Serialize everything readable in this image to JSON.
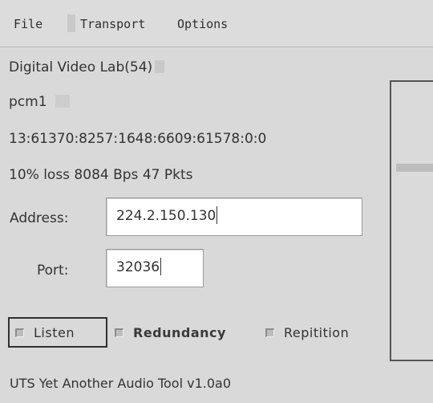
{
  "menu": {
    "items": [
      {
        "label": "File"
      },
      {
        "label": "Transport"
      },
      {
        "label": "Options"
      }
    ]
  },
  "session": {
    "name": "Digital Video Lab(54)",
    "codec": "pcm1",
    "counters": "13:61370:8257:1648:6609:61578:0:0",
    "stats": "10% loss 8084 Bps 47 Pkts"
  },
  "address": {
    "label": "Address:",
    "value": "224.2.150.130"
  },
  "port": {
    "label": "Port:",
    "value": "32036"
  },
  "options": {
    "listen": "Listen",
    "redundancy": "Redundancy",
    "repitition": "Repitition"
  },
  "status": {
    "text": "UTS Yet Another Audio Tool v1.0a0"
  }
}
